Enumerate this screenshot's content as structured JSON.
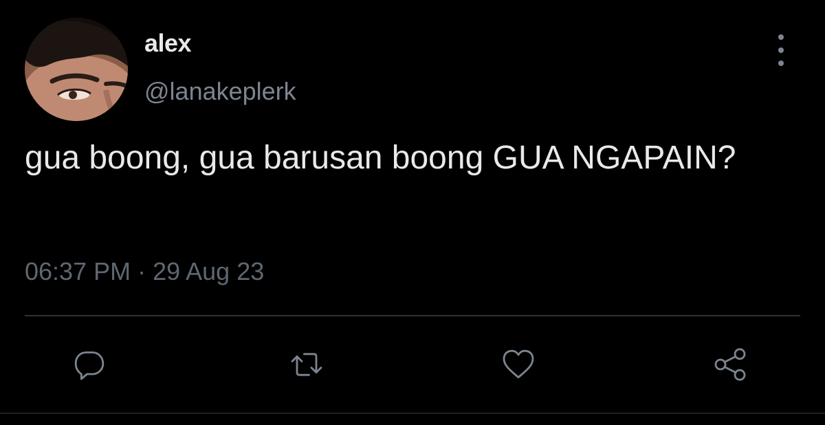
{
  "user": {
    "display_name": "alex",
    "handle": "@lanakeplerk"
  },
  "tweet": {
    "text": "gua boong, gua barusan boong GUA NGAPAIN?",
    "timestamp": "06:37 PM · 29 Aug 23"
  },
  "actions": {
    "reply_icon": "speech-bubble-icon",
    "retweet_icon": "retweet-arrows-icon",
    "like_icon": "heart-icon",
    "share_icon": "share-nodes-icon",
    "more_icon": "vertical-ellipsis-icon"
  },
  "colors": {
    "background": "#000000",
    "primary_text": "#e7e9ea",
    "secondary_text": "#7d8590",
    "divider": "#2f3336"
  }
}
